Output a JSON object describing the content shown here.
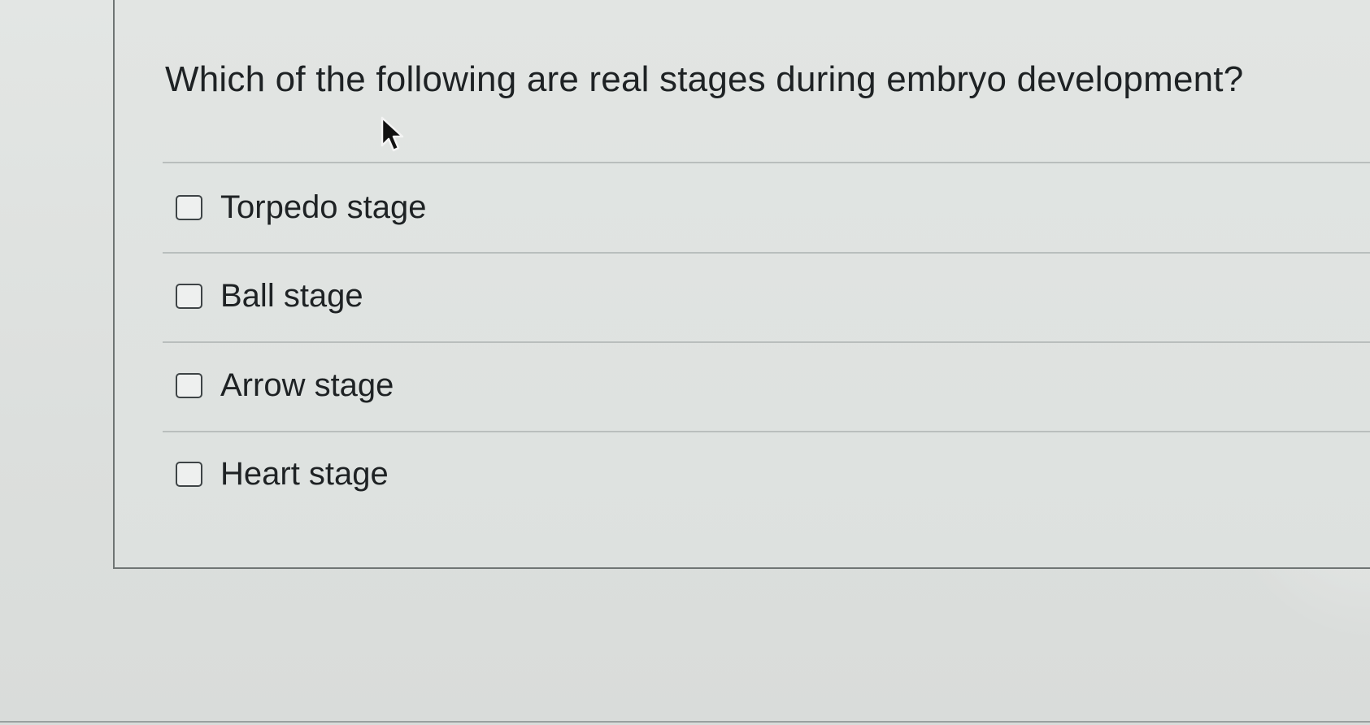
{
  "question": {
    "text": "Which of the following are real stages during embryo development?"
  },
  "options": [
    {
      "label": "Torpedo stage",
      "checked": false
    },
    {
      "label": "Ball stage",
      "checked": false
    },
    {
      "label": "Arrow stage",
      "checked": false
    },
    {
      "label": "Heart stage",
      "checked": false
    }
  ],
  "icons": {
    "cursor": "mouse-pointer-icon",
    "checkbox": "checkbox-icon"
  },
  "colors": {
    "text": "#1e2224",
    "divider": "#b9bebd",
    "panel_border": "#6f7574",
    "background": "#dfe2e0"
  }
}
